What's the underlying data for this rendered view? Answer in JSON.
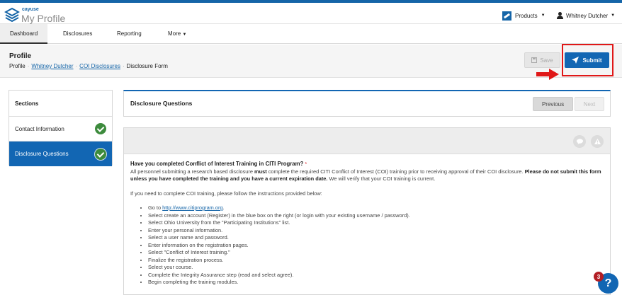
{
  "app": {
    "brand_small": "cayuse",
    "brand_title": "My Profile"
  },
  "topbar": {
    "products_label": "Products",
    "user_name": "Whitney Dutcher"
  },
  "nav": {
    "items": [
      {
        "label": "Dashboard"
      },
      {
        "label": "Disclosures"
      },
      {
        "label": "Reporting"
      },
      {
        "label": "More"
      }
    ]
  },
  "page": {
    "title": "Profile",
    "breadcrumb": [
      "Profile",
      "Whitney Dutcher",
      "COI Disclosures",
      "Disclosure Form"
    ]
  },
  "actions": {
    "save_label": "Save",
    "submit_label": "Submit"
  },
  "sections": {
    "heading": "Sections",
    "items": [
      {
        "label": "Contact Information"
      },
      {
        "label": "Disclosure Questions"
      }
    ]
  },
  "disclosure": {
    "title": "Disclosure Questions",
    "previous_label": "Previous",
    "next_label": "Next"
  },
  "question": {
    "title": "Have you completed Conflict of Interest Training in CITI Program?",
    "required_mark": "*",
    "intro_1": "All personnel submitting a research based disclosure ",
    "intro_must": "must",
    "intro_2": " complete the required CITI Conflict of Interest (COI) training prior to receiving approval of their COI disclosure. ",
    "intro_bold": "Please do not submit this form unless you have completed the training and you have a current expiration date.",
    "intro_3": "  We will verify that your COI training is current.",
    "instructions_intro": "If you need to complete COI training, please follow the instructions provided below:",
    "step_1_prefix": "Go to ",
    "step_1_link": "http://www.citiprogram.org",
    "step_1_suffix": ".",
    "steps": [
      "Select create an account (Register) in the blue box on the right (or login with your existing username / password).",
      "Select Ohio University from the \"Participating Institutions\" list.",
      "Enter your personal information.",
      "Select a user name and password.",
      "Enter information on the registration pages.",
      "Select \"Conflict of Interest training.\"",
      "Finalize the registration process.",
      "Select your course.",
      "Complete the Integrity Assurance step (read and select agree).",
      "Begin completing the training modules."
    ]
  },
  "help": {
    "badge_label": "?",
    "notification_count": "3"
  }
}
